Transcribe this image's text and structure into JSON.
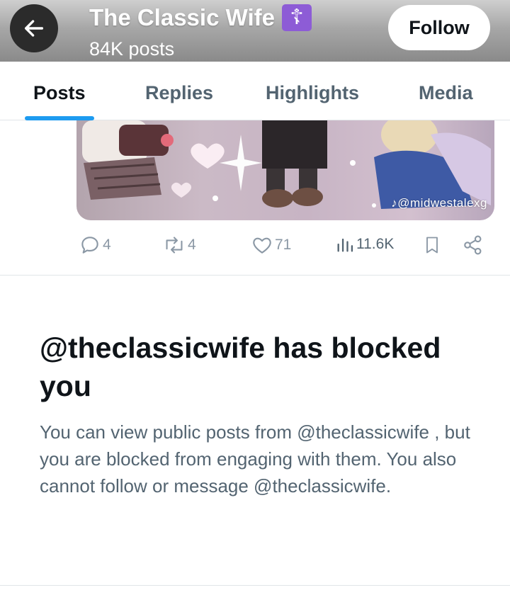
{
  "header": {
    "profile_name": "The Classic Wife",
    "badge_glyph": "☦",
    "post_count": "84K posts",
    "follow_label": "Follow",
    "back_icon": "arrow-left-icon"
  },
  "tabs": [
    {
      "label": "Posts",
      "active": true
    },
    {
      "label": "Replies",
      "active": false
    },
    {
      "label": "Highlights",
      "active": false
    },
    {
      "label": "Media",
      "active": false
    }
  ],
  "post": {
    "media_credit": "♪@midwestalexg",
    "actions": {
      "replies": "4",
      "reposts": "4",
      "likes": "71",
      "views": "11.6K"
    }
  },
  "blocked": {
    "title": "@theclassicwife has blocked you",
    "body": "You can view public posts from @theclassicwife , but you are blocked from engaging with them. You also cannot follow or message @theclassicwife."
  },
  "colors": {
    "accent": "#1d9bf0",
    "text_primary": "#0f1419",
    "text_secondary": "#536471",
    "badge": "#8d5cd6"
  }
}
